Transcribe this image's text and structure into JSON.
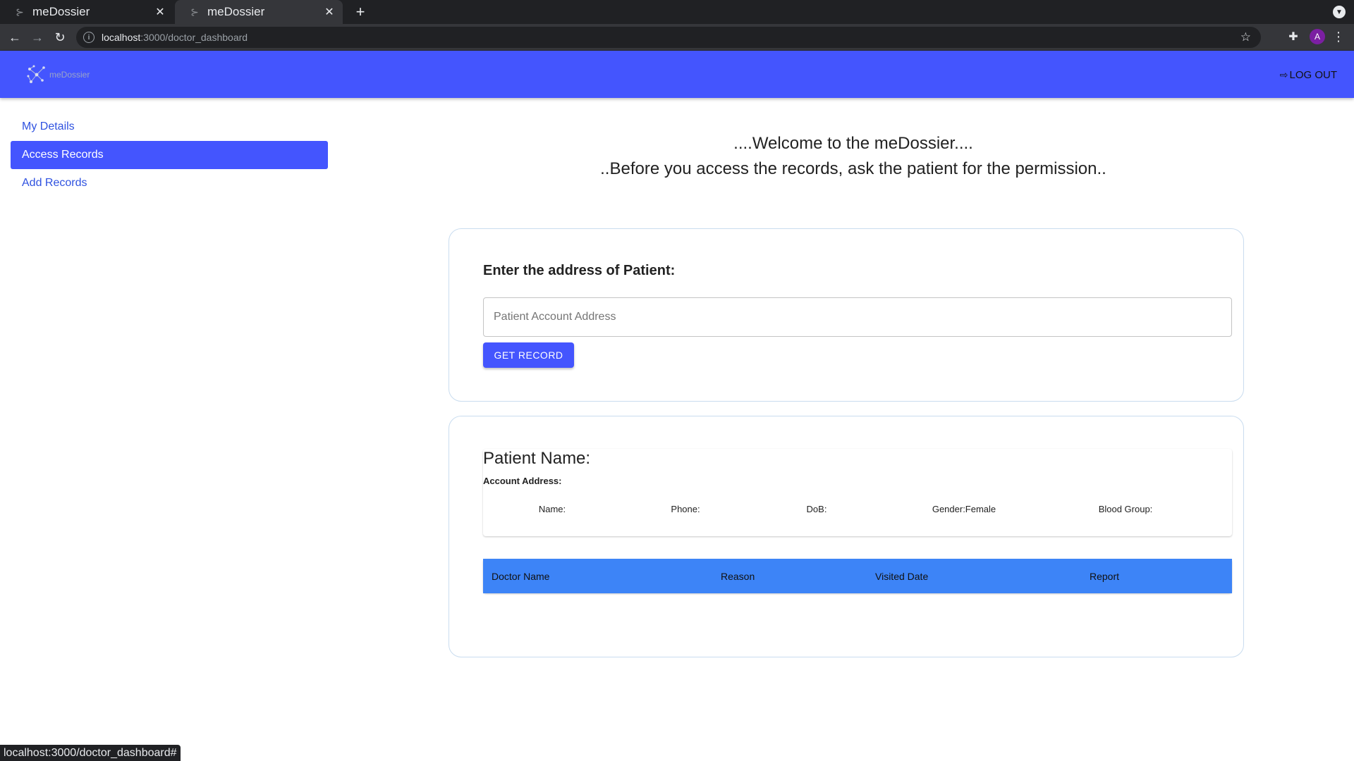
{
  "browser": {
    "tabs": [
      {
        "title": "meDossier"
      },
      {
        "title": "meDossier"
      }
    ],
    "url_host": "localhost",
    "url_path": ":3000/doctor_dashboard",
    "profile_initial": "A",
    "status_text": "localhost:3000/doctor_dashboard#"
  },
  "header": {
    "logo_text": "meDossier",
    "logout_label": "LOG OUT"
  },
  "sidebar": {
    "items": [
      {
        "label": "My Details",
        "active": false
      },
      {
        "label": "Access Records",
        "active": true
      },
      {
        "label": "Add Records",
        "active": false
      }
    ]
  },
  "welcome": {
    "line1": "....Welcome to the meDossier....",
    "line2": "..Before you access the records, ask the patient for the permission.."
  },
  "search": {
    "title": "Enter the address of Patient:",
    "placeholder": "Patient Account Address",
    "value": "",
    "button_label": "GET RECORD"
  },
  "patient": {
    "name_label": "Patient Name:",
    "address_label": "Account Address:",
    "fields": {
      "name": "Name:",
      "phone": "Phone:",
      "dob": "DoB:",
      "gender": "Gender:Female",
      "blood_group": "Blood Group:"
    }
  },
  "records": {
    "columns": [
      "Doctor Name",
      "Reason",
      "Visited Date",
      "Report"
    ],
    "rows": []
  },
  "colors": {
    "brand": "#4455fe",
    "table_header": "#3d84f7",
    "card_border": "#c9dcef"
  }
}
